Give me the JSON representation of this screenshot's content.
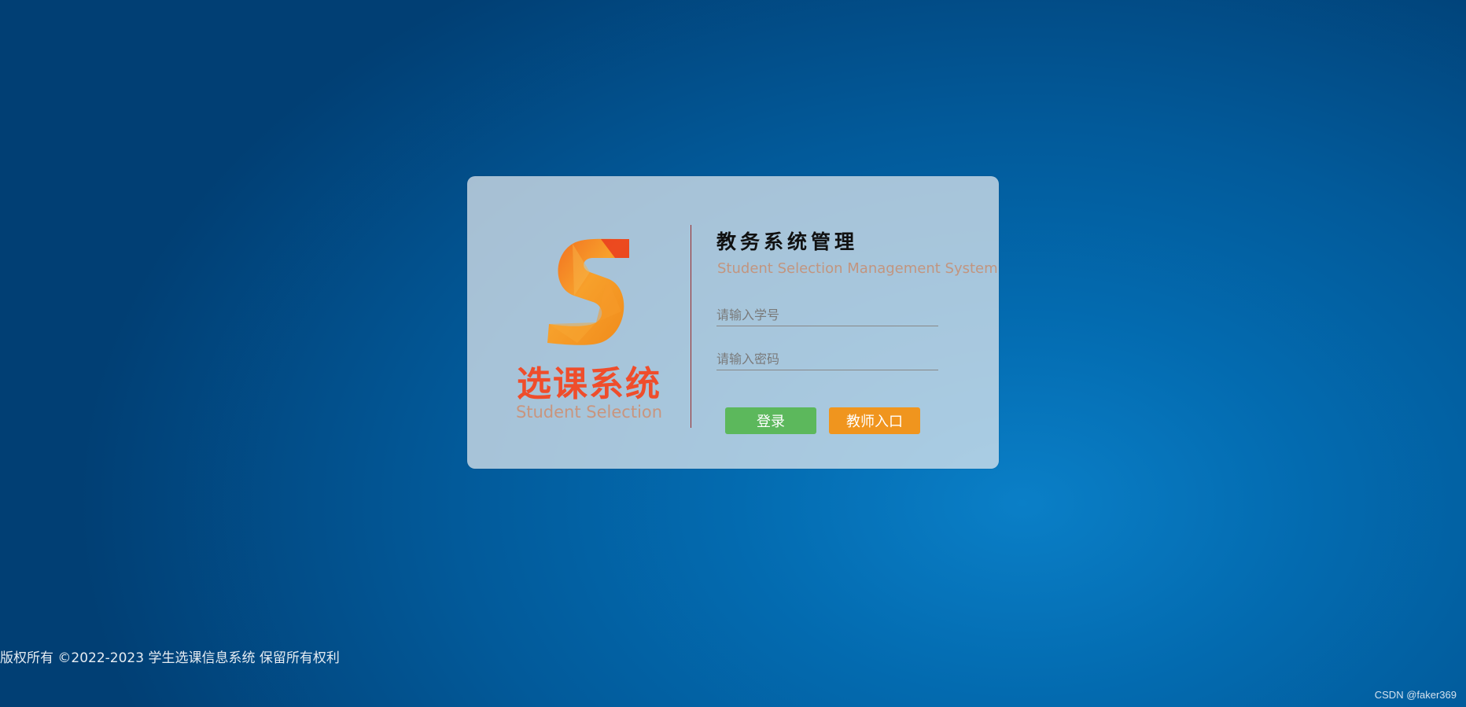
{
  "logo": {
    "title_cn": "选课系统",
    "title_en": "Student Selection",
    "icon": "s-logo-icon",
    "brand_color": "#ef4d2b"
  },
  "form": {
    "title_cn": "教务系统管理",
    "title_en": "Student Selection Management System",
    "student_id_placeholder": "请输入学号",
    "password_placeholder": "请输入密码",
    "login_label": "登录",
    "teacher_label": "教师入口"
  },
  "colors": {
    "login_button": "#5cb85c",
    "teacher_button": "#f0951e"
  },
  "footer": {
    "copyright": "版权所有 ©2022-2023 学生选课信息系统 保留所有权利"
  },
  "watermark": {
    "text": "CSDN @faker369"
  }
}
